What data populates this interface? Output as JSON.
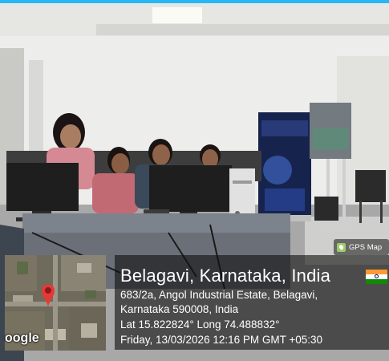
{
  "overlay": {
    "badge_label": "GPS Map",
    "place": "Belagavi, Karnataka, India",
    "address_line1": "683/2a, Angol Industrial Estate, Belagavi,",
    "address_line2": "Karnataka 590008, India",
    "coordinates": "Lat 15.822824° Long 74.488832°",
    "datetime": "Friday, 13/03/2026 12:16 PM GMT +05:30",
    "map_provider": "oogle"
  },
  "colors": {
    "accent": "#29b6f6",
    "pin": "#e53935",
    "flag_saffron": "#ff9933",
    "flag_green": "#138808"
  }
}
